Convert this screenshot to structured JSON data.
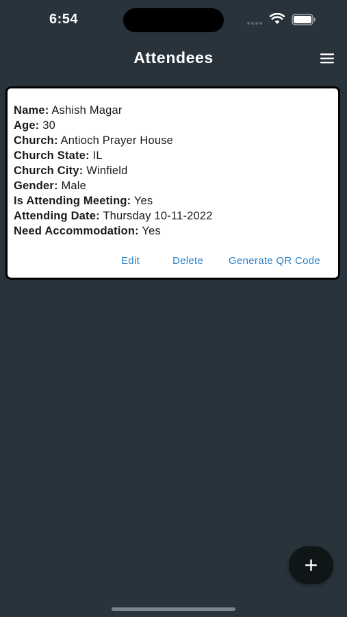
{
  "status_bar": {
    "time": "6:54",
    "icons": [
      "signal-dots-icon",
      "wifi-icon",
      "battery-icon"
    ]
  },
  "header": {
    "title": "Attendees",
    "menu_icon": "hamburger-menu-icon"
  },
  "attendee_card": {
    "fields": [
      {
        "label": "Name:",
        "value": "Ashish Magar"
      },
      {
        "label": "Age:",
        "value": "30"
      },
      {
        "label": "Church:",
        "value": "Antioch Prayer House"
      },
      {
        "label": "Church State:",
        "value": "IL"
      },
      {
        "label": "Church City:",
        "value": "Winfield"
      },
      {
        "label": "Gender:",
        "value": "Male"
      },
      {
        "label": "Is Attending Meeting:",
        "value": "Yes"
      },
      {
        "label": "Attending Date:",
        "value": "Thursday 10-11-2022"
      },
      {
        "label": "Need Accommodation:",
        "value": "Yes"
      }
    ],
    "actions": {
      "edit": "Edit",
      "delete": "Delete",
      "generate_qr": "Generate QR Code"
    }
  },
  "fab": {
    "icon": "plus-icon"
  },
  "colors": {
    "background": "#28333b",
    "card": "#ffffff",
    "link": "#2a7fc9",
    "fab": "#101518"
  }
}
